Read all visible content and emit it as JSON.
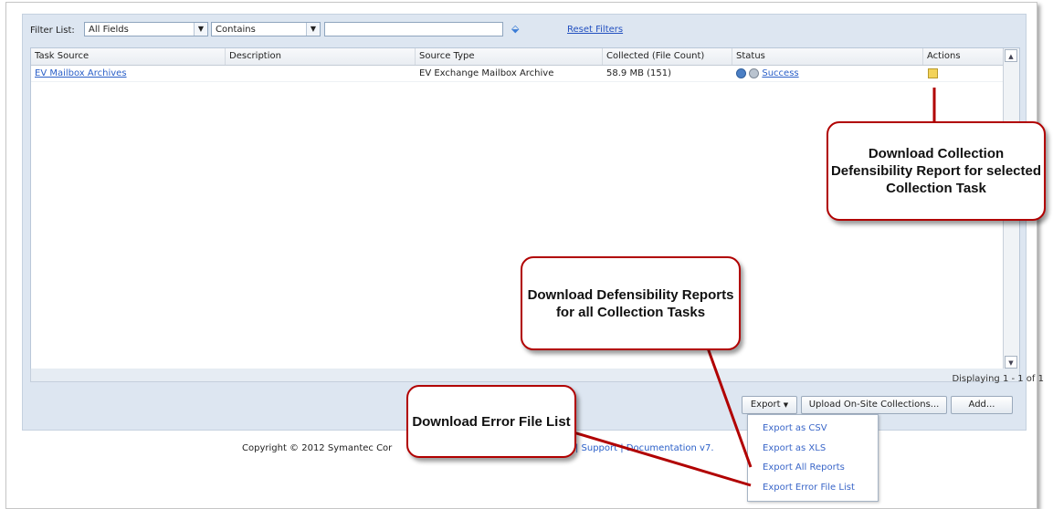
{
  "filter": {
    "label": "Filter List:",
    "field": "All Fields",
    "operator": "Contains",
    "value": "",
    "reset": "Reset Filters"
  },
  "grid": {
    "columns": [
      "Task Source",
      "Description",
      "Source Type",
      "Collected (File Count)",
      "Status",
      "Actions"
    ],
    "rows": [
      {
        "task_source": "EV Mailbox Archives",
        "description": "",
        "source_type": "EV Exchange Mailbox Archive",
        "collected": "58.9 MB (151)",
        "status": "Success"
      }
    ]
  },
  "pager": {
    "displaying": "Displaying 1 - 1 of 1"
  },
  "buttons": {
    "export": "Export",
    "upload": "Upload On-Site Collections...",
    "add": "Add..."
  },
  "export_menu": [
    "Export as CSV",
    "Export as XLS",
    "Export All Reports",
    "Export Error File List"
  ],
  "footer": {
    "copyright": "Copyright © 2012 Symantec Cor",
    "links_partial": "k | Support | Documentation  v7."
  },
  "callouts": {
    "collection_report": "Download Collection Defensibility Report for selected Collection Task",
    "all_reports": "Download Defensibility Reports for all Collection Tasks",
    "error_list": "Download Error File List"
  },
  "colors": {
    "callout_border": "#b10000",
    "link": "#2a5fc8",
    "panel": "#dde6f1"
  }
}
